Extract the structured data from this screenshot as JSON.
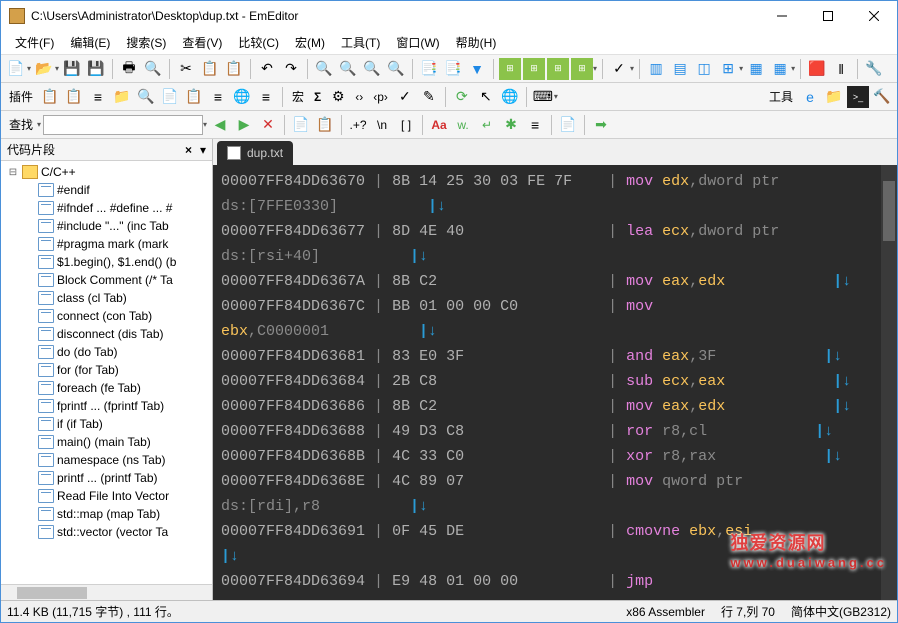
{
  "window": {
    "title": "C:\\Users\\Administrator\\Desktop\\dup.txt - EmEditor"
  },
  "menu": {
    "file": "文件(F)",
    "edit": "编辑(E)",
    "search": "搜索(S)",
    "view": "查看(V)",
    "compare": "比较(C)",
    "macro": "宏(M)",
    "tools": "工具(T)",
    "window": "窗口(W)",
    "help": "帮助(H)"
  },
  "toolbar_labels": {
    "plugins": "插件",
    "macro": "宏",
    "sigma": "Σ",
    "angle": "‹›",
    "php": "‹p›",
    "tools": "工具",
    "find": "查找",
    "regex1": ".+?",
    "escape": "\\n",
    "brackets": "[ ]",
    "aa": "Aa",
    "word": "w.",
    "arrow": "↵"
  },
  "sidebar": {
    "title": "代码片段",
    "root": "C/C++",
    "items": [
      "#endif",
      "#ifndef ... #define ... #",
      "#include \"...\"   (inc Tab",
      "#pragma mark   (mark",
      "$1.begin(), $1.end()   (b",
      "Block Comment   (/* Ta",
      "class   (cl Tab)",
      "connect   (con Tab)",
      "disconnect   (dis Tab)",
      "do   (do Tab)",
      "for   (for Tab)",
      "foreach   (fe Tab)",
      "fprintf ...   (fprintf Tab)",
      "if   (if Tab)",
      "main()   (main Tab)",
      "namespace   (ns Tab)",
      "printf ...   (printf Tab)",
      "Read File Into Vector",
      "std::map   (map Tab)",
      "std::vector   (vector Ta"
    ]
  },
  "tab": {
    "filename": "dup.txt"
  },
  "editor": {
    "lines": [
      {
        "addr": "00007FF84DD63670",
        "bytes": "8B 14 25 30 03 FE 7F",
        "mnem": "mov",
        "args_pre": " ",
        "reg": "edx",
        "args_post": ",dword ptr"
      },
      {
        "cont": "ds:[7FFE0330]",
        "arrow": true
      },
      {
        "addr": "00007FF84DD63677",
        "bytes": "8D 4E 40",
        "mnem": "lea",
        "args_pre": " ",
        "reg": "ecx",
        "args_post": ",dword ptr"
      },
      {
        "cont": "ds:[rsi+40]",
        "arrow": true
      },
      {
        "addr": "00007FF84DD6367A",
        "bytes": "8B C2",
        "mnem": "mov",
        "args_pre": " ",
        "reg": "eax",
        "args_post": ",",
        "reg2": "edx",
        "tail_arrow": true
      },
      {
        "addr": "00007FF84DD6367C",
        "bytes": "BB 01 00 00 C0",
        "mnem": "mov",
        "args_pre": ""
      },
      {
        "reg_cont": "ebx",
        "cont": ",C0000001",
        "arrow": true
      },
      {
        "addr": "00007FF84DD63681",
        "bytes": "83 E0 3F",
        "mnem": "and",
        "args_pre": " ",
        "reg": "eax",
        "args_post": ",3F",
        "tail_arrow": true
      },
      {
        "addr": "00007FF84DD63684",
        "bytes": "2B C8",
        "mnem": "sub",
        "args_pre": " ",
        "reg": "ecx",
        "args_post": ",",
        "reg2": "eax",
        "tail_arrow": true
      },
      {
        "addr": "00007FF84DD63686",
        "bytes": "8B C2",
        "mnem": "mov",
        "args_pre": " ",
        "reg": "eax",
        "args_post": ",",
        "reg2": "edx",
        "tail_arrow": true
      },
      {
        "addr": "00007FF84DD63688",
        "bytes": "49 D3 C8",
        "mnem": "ror",
        "args_pre": " ",
        "muted": "r8,cl",
        "tail_arrow": true
      },
      {
        "addr": "00007FF84DD6368B",
        "bytes": "4C 33 C0",
        "mnem": "xor",
        "args_pre": " ",
        "muted": "r8,rax",
        "tail_arrow": true
      },
      {
        "addr": "00007FF84DD6368E",
        "bytes": "4C 89 07",
        "mnem": "mov",
        "args_pre": " qword ptr"
      },
      {
        "cont": "ds:[rdi],r8",
        "arrow": true
      },
      {
        "addr": "00007FF84DD63691",
        "bytes": "0F 45 DE",
        "mnem": "cmovne",
        "args_pre": " ",
        "reg": "ebx",
        "args_post": ",",
        "reg2": "esi"
      },
      {
        "arrow_only": true
      },
      {
        "addr": "00007FF84DD63694",
        "bytes": "E9 48 01 00 00",
        "mnem": "jmp",
        "args_pre": ""
      }
    ]
  },
  "status": {
    "left": "11.4 KB (11,715 字节) , 111 行。",
    "lang": "x86 Assembler",
    "pos": "行 7,列 70",
    "encoding": "简体中文(GB2312)"
  },
  "watermark": {
    "name": "独爱资源网",
    "url": "www.duaiwang.cc"
  }
}
